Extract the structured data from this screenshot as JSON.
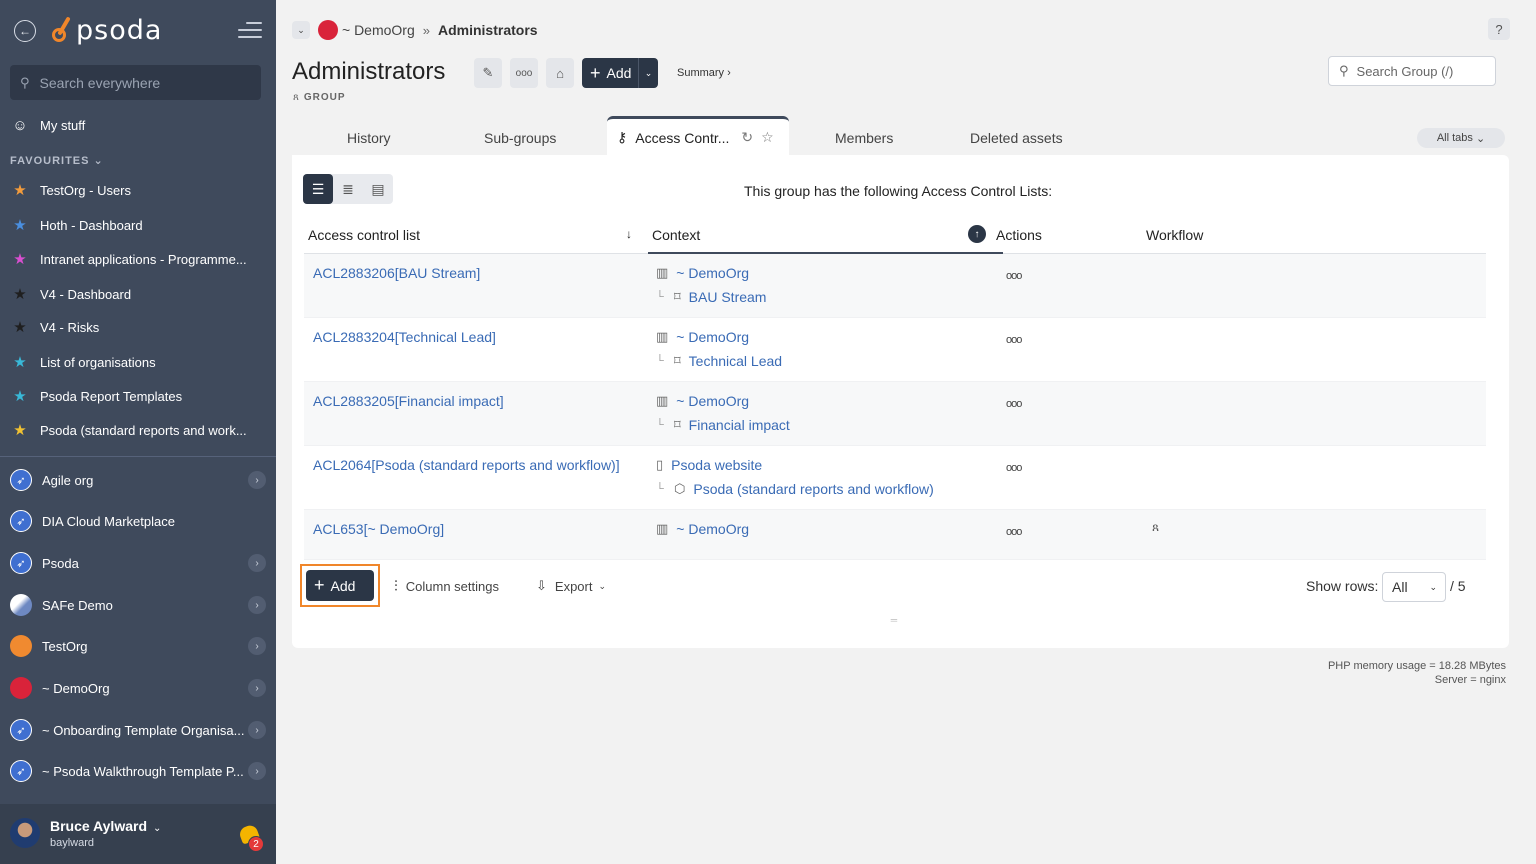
{
  "sidebar": {
    "logo_text": "psoda",
    "search_placeholder": "Search everywhere",
    "my_stuff": "My stuff",
    "favourites_title": "FAVOURITES",
    "favourites": [
      {
        "label": "TestOrg - Users",
        "star_color": "#f39c3c"
      },
      {
        "label": "Hoth - Dashboard",
        "star_color": "#4a8fe0"
      },
      {
        "label": "Intranet applications - Programme...",
        "star_color": "#d94fd0"
      },
      {
        "label": "V4 - Dashboard",
        "star_color": "#2b2b2b"
      },
      {
        "label": "V4 - Risks",
        "star_color": "#2b2b2b"
      },
      {
        "label": "List of organisations",
        "star_color": "#39b9d8"
      },
      {
        "label": "Psoda Report Templates",
        "star_color": "#39b9d8"
      },
      {
        "label": "Psoda (standard reports and work...",
        "star_color": "#f1c232"
      }
    ],
    "orgs": [
      {
        "label": "Agile org",
        "icon": "rocket",
        "chevron": true
      },
      {
        "label": "DIA Cloud Marketplace",
        "icon": "rocket",
        "chevron": false
      },
      {
        "label": "Psoda",
        "icon": "rocket",
        "chevron": true
      },
      {
        "label": "SAFe Demo",
        "icon": "safe",
        "chevron": true
      },
      {
        "label": "TestOrg",
        "icon": "test",
        "chevron": true
      },
      {
        "label": "~ DemoOrg",
        "icon": "demo",
        "chevron": true
      },
      {
        "label": "~ Onboarding Template Organisa...",
        "icon": "rocket",
        "chevron": true
      },
      {
        "label": "~ Psoda Walkthrough Template P...",
        "icon": "rocket",
        "chevron": true
      }
    ],
    "user": {
      "name": "Bruce Aylward",
      "login": "baylward",
      "notifications": "2"
    }
  },
  "header": {
    "breadcrumb_org": "~ DemoOrg",
    "breadcrumb_sep": "»",
    "breadcrumb_current": "Administrators",
    "help": "?",
    "title": "Administrators",
    "type_label": "GROUP",
    "add_label": "Add",
    "summary_link": "Summary ›",
    "search_placeholder": "Search Group (/)"
  },
  "tabs": {
    "history": "History",
    "subgroups": "Sub-groups",
    "access": "Access Contr...",
    "members": "Members",
    "deleted": "Deleted assets",
    "all_tabs": "All tabs"
  },
  "panel": {
    "caption": "This group has the following Access Control Lists:",
    "columns": {
      "acl": "Access control list",
      "context": "Context",
      "actions": "Actions",
      "workflow": "Workflow"
    },
    "rows": [
      {
        "acl": "ACL2883206[BAU Stream]",
        "ctx1": "~ DemoOrg",
        "ctx2": "BAU Stream",
        "ctx1_icon": "building-icon",
        "ctx2_icon": "tag-icon",
        "workflow": ""
      },
      {
        "acl": "ACL2883204[Technical Lead]",
        "ctx1": "~ DemoOrg",
        "ctx2": "Technical Lead",
        "ctx1_icon": "building-icon",
        "ctx2_icon": "tag-icon",
        "workflow": ""
      },
      {
        "acl": "ACL2883205[Financial impact]",
        "ctx1": "~ DemoOrg",
        "ctx2": "Financial impact",
        "ctx1_icon": "building-icon",
        "ctx2_icon": "tag-icon",
        "workflow": ""
      },
      {
        "acl": "ACL2064[Psoda (standard reports and workflow)]",
        "ctx1": "Psoda website",
        "ctx2": "Psoda (standard reports and workflow)",
        "ctx1_icon": "book-icon",
        "ctx2_icon": "package-icon",
        "workflow": ""
      },
      {
        "acl": "ACL653[~ DemoOrg]",
        "ctx1": "~ DemoOrg",
        "ctx2": "",
        "ctx1_icon": "building-icon",
        "ctx2_icon": "",
        "workflow": "group"
      }
    ],
    "actions_glyph": "ooo",
    "add_label": "Add",
    "column_settings": "Column settings",
    "export": "Export",
    "show_rows_label": "Show rows:",
    "show_rows_value": "All",
    "rows_total": "/ 5"
  },
  "footer": {
    "memory": "PHP memory usage = 18.28 MBytes",
    "server": "Server = nginx"
  }
}
